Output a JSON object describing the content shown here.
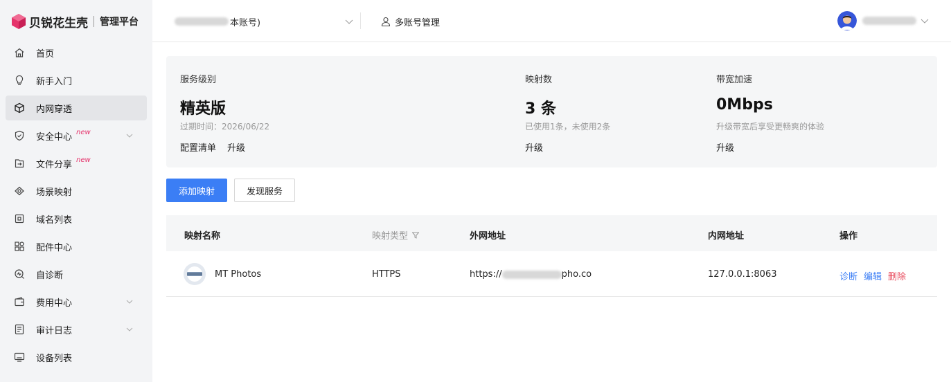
{
  "brand": {
    "name": "贝锐花生壳",
    "subtitle": "管理平台",
    "accent": "#e5336b"
  },
  "sidebar": {
    "items": [
      {
        "label": "首页",
        "icon": "home-icon"
      },
      {
        "label": "新手入门",
        "icon": "lightbulb-icon"
      },
      {
        "label": "内网穿透",
        "icon": "cube-icon",
        "active": true
      },
      {
        "label": "安全中心",
        "icon": "shield-icon",
        "badge": "new",
        "expandable": true
      },
      {
        "label": "文件分享",
        "icon": "file-share-icon",
        "badge": "new"
      },
      {
        "label": "场景映射",
        "icon": "scene-icon"
      },
      {
        "label": "域名列表",
        "icon": "domain-icon"
      },
      {
        "label": "配件中心",
        "icon": "apps-icon"
      },
      {
        "label": "自诊断",
        "icon": "diagnose-icon"
      },
      {
        "label": "费用中心",
        "icon": "wallet-icon",
        "expandable": true
      },
      {
        "label": "审计日志",
        "icon": "log-icon",
        "expandable": true
      },
      {
        "label": "设备列表",
        "icon": "monitor-icon"
      }
    ]
  },
  "header": {
    "account_suffix": "本账号)",
    "multi_account_label": "多账号管理"
  },
  "summary": {
    "service": {
      "title": "服务级别",
      "value": "精英版",
      "note": "过期时间：2026/06/22",
      "links": [
        "配置清单",
        "升级"
      ]
    },
    "mappings": {
      "title": "映射数",
      "value": "3 条",
      "note": "已使用1条，未使用2条",
      "links": [
        "升级"
      ]
    },
    "bandwidth": {
      "title": "带宽加速",
      "value": "0Mbps",
      "note": "升级带宽后享受更畅爽的体验",
      "links": [
        "升级"
      ]
    }
  },
  "actions": {
    "add_label": "添加映射",
    "discover_label": "发现服务",
    "primary_color": "#3b7ef5"
  },
  "table": {
    "headers": {
      "name": "映射名称",
      "type": "映射类型",
      "external": "外网地址",
      "internal": "内网地址",
      "ops": "操作"
    },
    "rows": [
      {
        "name": "MT Photos",
        "type": "HTTPS",
        "external_prefix": "https://",
        "external_suffix": "pho.co",
        "internal": "127.0.0.1:8063",
        "ops": [
          "诊断",
          "编辑",
          "删除"
        ]
      }
    ]
  }
}
